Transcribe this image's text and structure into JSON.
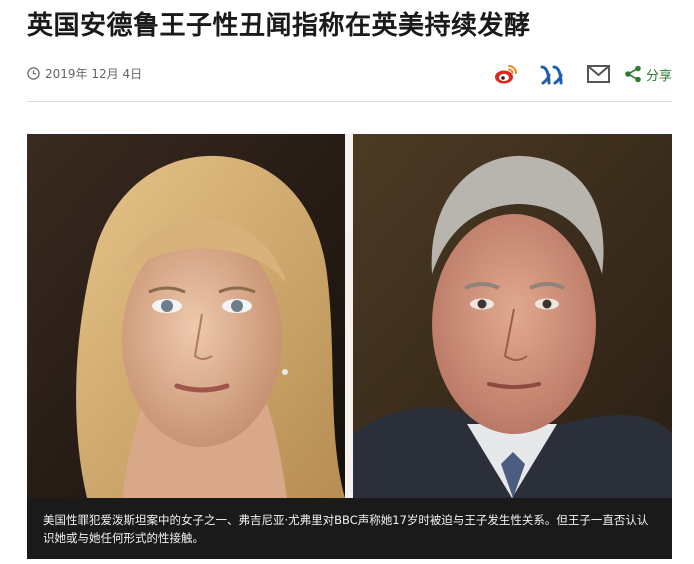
{
  "article": {
    "headline": "英国安德鲁王子性丑闻指称在英美持续发酵",
    "date": "2019年 12月 4日",
    "caption": "美国性罪犯爱泼斯坦案中的女子之一、弗吉尼亚·尤弗里对BBC声称她17岁时被迫与王子发生性关系。但王子一直否认认识她或与她任何形式的性接触。"
  },
  "share": {
    "label": "分享",
    "icons": [
      "weibo-icon",
      "renren-icon",
      "mail-icon",
      "share-icon"
    ]
  },
  "colors": {
    "weibo": "#d52b1e",
    "renren": "#1f5fa8",
    "mail": "#555555",
    "share": "#2e7d32",
    "caption_bg": "#1a1a1a"
  }
}
